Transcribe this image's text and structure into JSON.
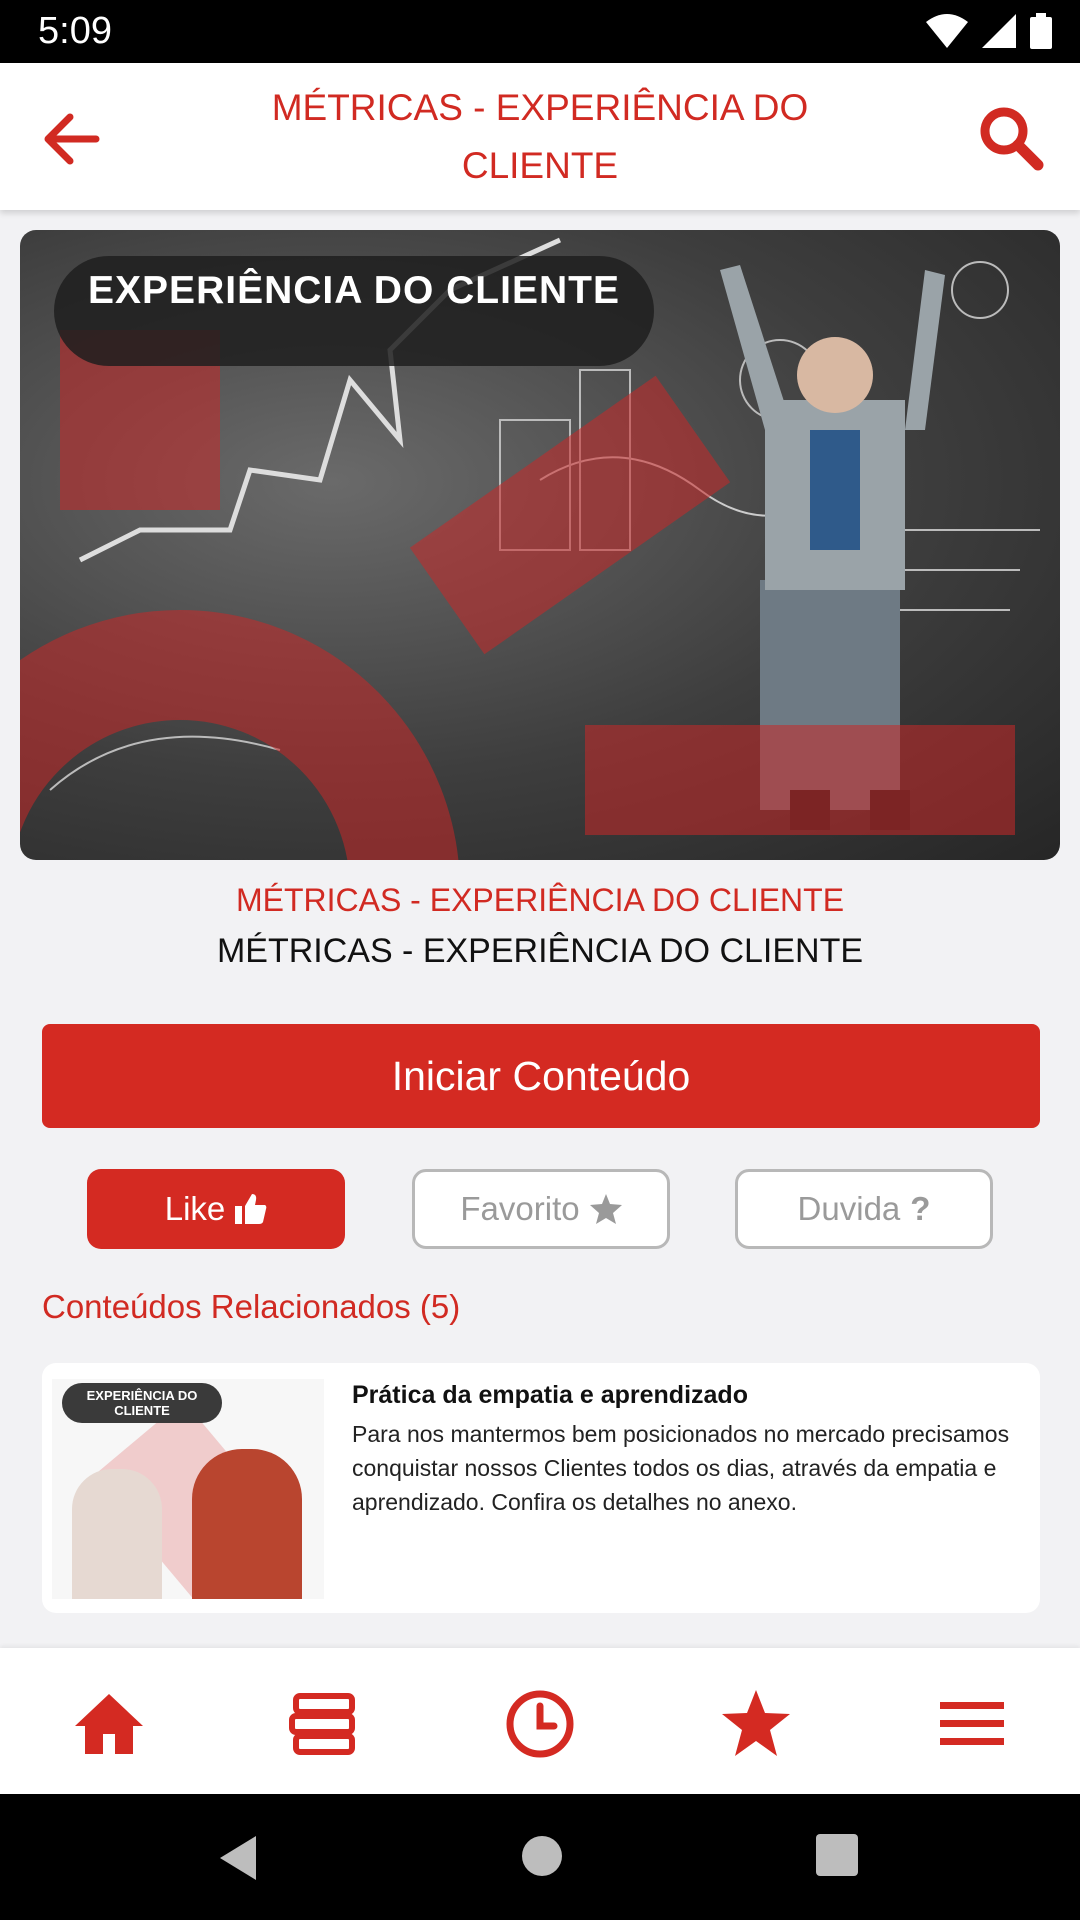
{
  "status_bar": {
    "time": "5:09"
  },
  "header": {
    "title": "MÉTRICAS - EXPERIÊNCIA DO CLIENTE",
    "back_icon": "arrow-left-icon",
    "search_icon": "search-icon"
  },
  "hero": {
    "banner_text": "EXPERIÊNCIA DO CLIENTE"
  },
  "content": {
    "category": "MÉTRICAS - EXPERIÊNCIA DO CLIENTE",
    "title": "MÉTRICAS - EXPERIÊNCIA DO CLIENTE",
    "start_button": "Iniciar Conteúdo"
  },
  "actions": {
    "like": "Like",
    "favorite": "Favorito",
    "doubt": "Duvida"
  },
  "related": {
    "heading": "Conteúdos Relacionados (5)",
    "items": [
      {
        "thumb_banner": "EXPERIÊNCIA DO CLIENTE",
        "title": "Prática da empatia e aprendizado",
        "description": "Para nos mantermos bem posicionados no mercado precisamos conquistar nossos Clientes todos os dias, através da empatia e aprendizado. Confira os detalhes no anexo."
      }
    ]
  },
  "bottom_nav": [
    "home-icon",
    "books-icon",
    "clock-icon",
    "star-icon",
    "menu-icon"
  ],
  "colors": {
    "accent": "#d42a22",
    "background": "#f2f2f4"
  }
}
